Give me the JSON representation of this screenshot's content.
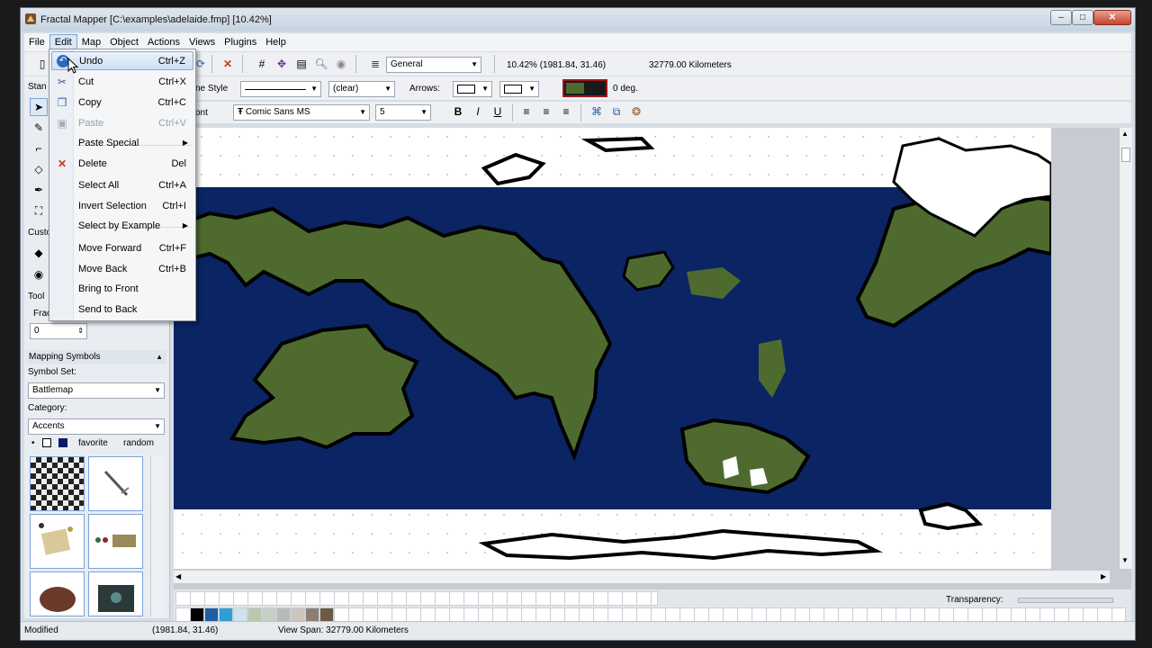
{
  "window": {
    "title": "Fractal Mapper [C:\\examples\\adelaide.fmp] [10.42%]",
    "buttons": {
      "minimize": "–",
      "maximize": "□",
      "close": "✕"
    }
  },
  "menubar": {
    "items": [
      "File",
      "Edit",
      "Map",
      "Object",
      "Actions",
      "Views",
      "Plugins",
      "Help"
    ],
    "active": "Edit"
  },
  "toolbar1": {
    "layer_combo": "General",
    "zoom_info": "10.42%  (1981.84, 31.46)",
    "span_info": "32779.00 Kilometers"
  },
  "toolbar2": {
    "line_style_label": "ne Style",
    "fill_combo": "(clear)",
    "arrows_label": "Arrows:",
    "angle": "0 deg."
  },
  "toolbar3": {
    "font_label": "ont",
    "font_combo": "Comic Sans MS",
    "size_combo": "5",
    "bold": "B",
    "italic": "I",
    "underline": "U"
  },
  "left_panel": {
    "standard_label": "Stan",
    "custom_label": "Custo",
    "tool_label": "Tool",
    "frac_label": "Frac",
    "frac_value": "0",
    "mapping_symbols": "Mapping Symbols",
    "symbol_set_label": "Symbol Set:",
    "symbol_set_value": "Battlemap",
    "category_label": "Category:",
    "category_value": "Accents",
    "favorite_label": "favorite",
    "random_label": "random"
  },
  "edit_menu": {
    "items": [
      {
        "label": "Undo",
        "shortcut": "Ctrl+Z",
        "icon": "undo-icon",
        "state": "highlighted"
      },
      {
        "label": "Cut",
        "shortcut": "Ctrl+X",
        "icon": "scissors-icon",
        "state": "normal"
      },
      {
        "label": "Copy",
        "shortcut": "Ctrl+C",
        "icon": "copy-icon",
        "state": "normal"
      },
      {
        "label": "Paste",
        "shortcut": "Ctrl+V",
        "icon": "paste-icon",
        "state": "disabled"
      },
      {
        "label": "Paste Special",
        "shortcut": "",
        "icon": "",
        "state": "submenu"
      },
      {
        "label": "Delete",
        "shortcut": "Del",
        "icon": "delete-x-icon",
        "state": "normal"
      },
      {
        "label": "Select All",
        "shortcut": "Ctrl+A",
        "icon": "",
        "state": "normal"
      },
      {
        "label": "Invert Selection",
        "shortcut": "Ctrl+I",
        "icon": "",
        "state": "normal"
      },
      {
        "label": "Select by Example",
        "shortcut": "",
        "icon": "",
        "state": "submenu"
      },
      {
        "label": "Move Forward",
        "shortcut": "Ctrl+F",
        "icon": "",
        "state": "normal"
      },
      {
        "label": "Move Back",
        "shortcut": "Ctrl+B",
        "icon": "",
        "state": "normal"
      },
      {
        "label": "Bring to Front",
        "shortcut": "",
        "icon": "",
        "state": "normal"
      },
      {
        "label": "Send to Back",
        "shortcut": "",
        "icon": "",
        "state": "normal"
      }
    ]
  },
  "palette": {
    "transparency_label": "Transparency:",
    "colors": [
      "#000000",
      "#1f5fa0",
      "#2f9fd8",
      "#cfe3ee",
      "#b9c7b0",
      "#c8cfc3",
      "#b9b9b9",
      "#cbc6bc",
      "#8b7f72",
      "#6b5a44"
    ]
  },
  "status": {
    "state": "Modified",
    "coords": "(1981.84, 31.46)",
    "view_span": "View Span: 32779.00 Kilometers"
  },
  "colors": {
    "ocean": "#0a2464",
    "land": "#4f6a2e",
    "land_light": "#7f8f4e",
    "snow": "#ffffff"
  }
}
